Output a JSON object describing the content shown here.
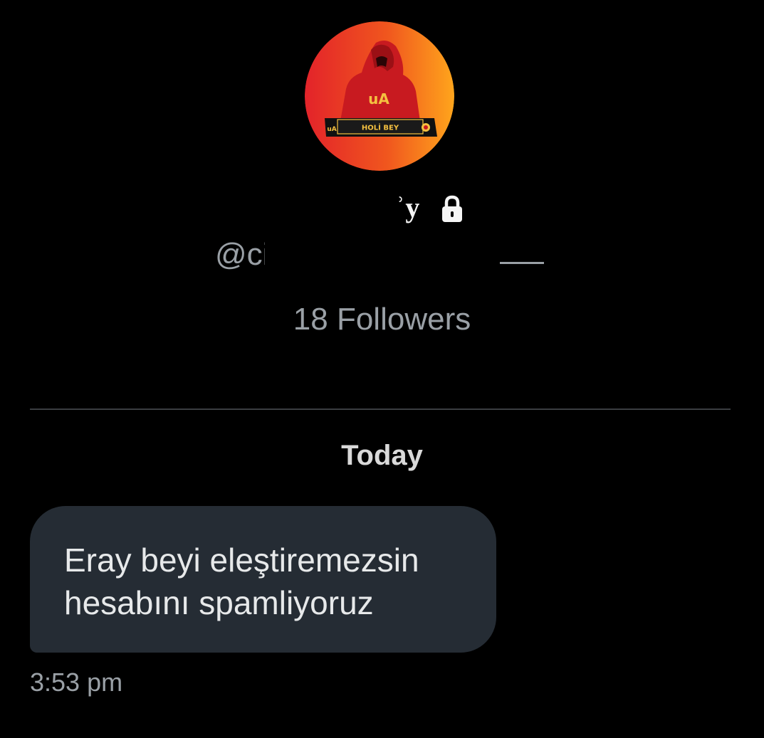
{
  "profile": {
    "avatar_text": "uA",
    "avatar_banner": "HOLİ BEY",
    "display_name": "ʾy",
    "lock_icon": "lock-icon",
    "handle_visible": "@ci",
    "followers": "18 Followers"
  },
  "conversation": {
    "date_separator": "Today",
    "messages": [
      {
        "text": "Eray beyi eleştiremezsin\nhesabını spamliyoruz",
        "time": "3:53 pm"
      }
    ]
  },
  "colors": {
    "background": "#000000",
    "bubble": "#252c34",
    "secondary_text": "#9aa0a6",
    "avatar_red": "#e3232a",
    "avatar_yellow": "#ffa51c"
  }
}
